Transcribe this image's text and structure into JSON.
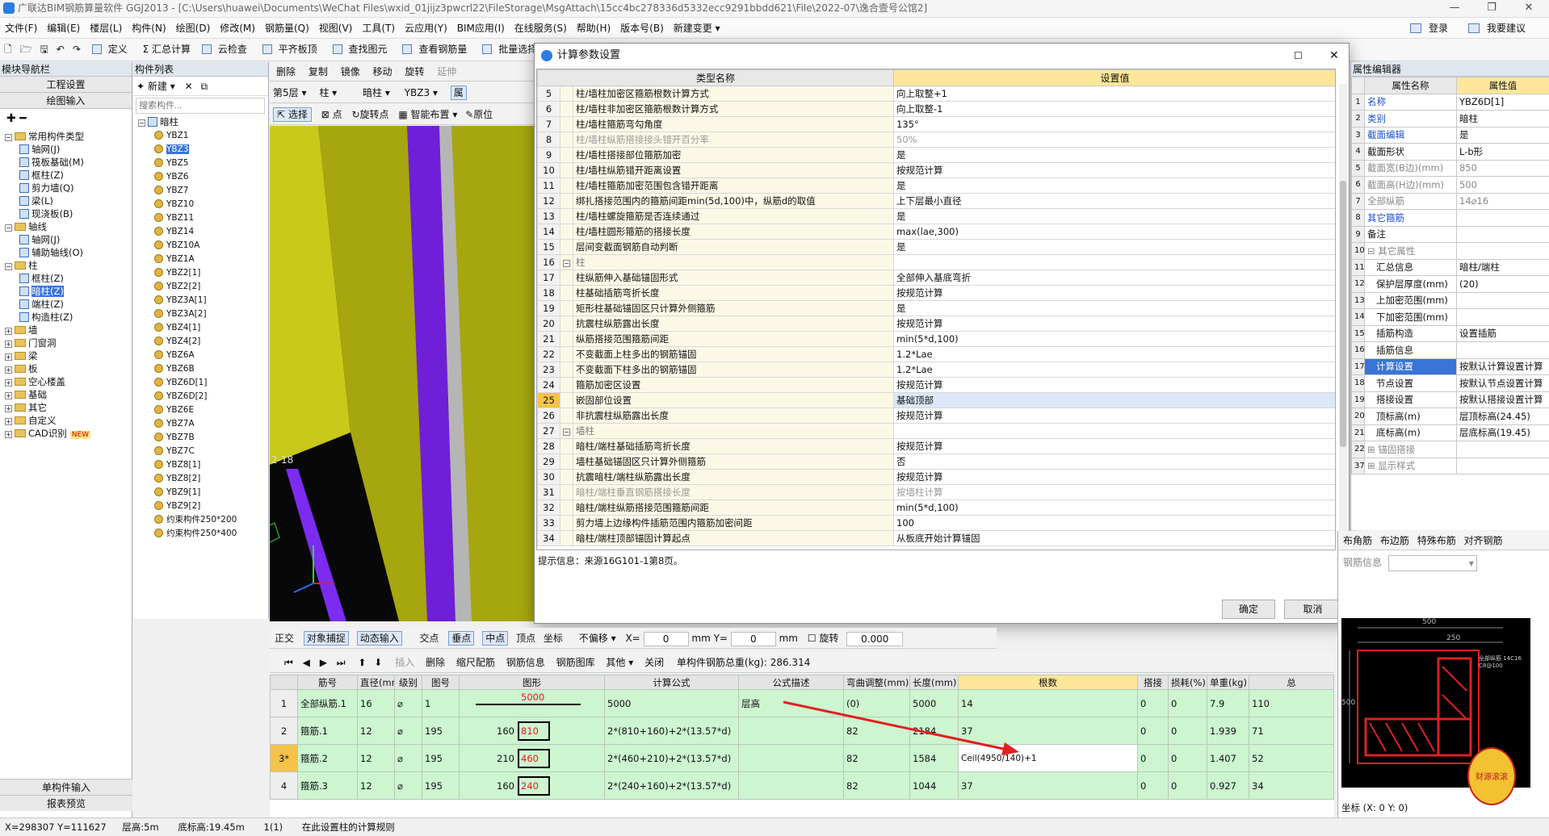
{
  "app": {
    "title": "广联达BIM钢筋算量软件 GGJ2013 - [C:\\Users\\huawei\\Documents\\WeChat Files\\wxid_01jijz3pwcrl22\\FileStorage\\MsgAttach\\15cc4bc278336d5332ecc9291bbdd621\\File\\2022-07\\逸合壹号公馆2]"
  },
  "menu": [
    "文件(F)",
    "编辑(E)",
    "楼层(L)",
    "构件(N)",
    "绘图(D)",
    "修改(M)",
    "钢筋量(Q)",
    "视图(V)",
    "工具(T)",
    "云应用(Y)",
    "BIM应用(I)",
    "在线服务(S)",
    "帮助(H)",
    "版本号(B)",
    "新建变更 ▾"
  ],
  "menu_right": {
    "login": "登录",
    "suggest": "我要建议"
  },
  "toolbar": [
    "定义",
    "Σ 汇总计算",
    "云检查",
    "平齐板顶",
    "查找图元",
    "查看钢筋量",
    "批量选择"
  ],
  "nav": {
    "title": "模块导航栏",
    "btn_project": "工程设置",
    "btn_draw": "绘图输入",
    "tree": [
      {
        "label": "常用构件类型",
        "type": "folder",
        "level": 0,
        "exp": "−"
      },
      {
        "label": "轴网(J)",
        "type": "leaf",
        "level": 1
      },
      {
        "label": "筏板基础(M)",
        "type": "leaf",
        "level": 1
      },
      {
        "label": "框柱(Z)",
        "type": "leaf",
        "level": 1
      },
      {
        "label": "剪力墙(Q)",
        "type": "leaf",
        "level": 1
      },
      {
        "label": "梁(L)",
        "type": "leaf",
        "level": 1
      },
      {
        "label": "现浇板(B)",
        "type": "leaf",
        "level": 1
      },
      {
        "label": "轴线",
        "type": "folder",
        "level": 0,
        "exp": "−"
      },
      {
        "label": "轴网(J)",
        "type": "leaf",
        "level": 1
      },
      {
        "label": "辅助轴线(O)",
        "type": "leaf",
        "level": 1
      },
      {
        "label": "柱",
        "type": "folder",
        "level": 0,
        "exp": "−"
      },
      {
        "label": "框柱(Z)",
        "type": "leaf",
        "level": 1
      },
      {
        "label": "暗柱(Z)",
        "type": "leaf",
        "level": 1,
        "selected": true
      },
      {
        "label": "端柱(Z)",
        "type": "leaf",
        "level": 1
      },
      {
        "label": "构造柱(Z)",
        "type": "leaf",
        "level": 1
      },
      {
        "label": "墙",
        "type": "folder",
        "level": 0,
        "exp": "+"
      },
      {
        "label": "门窗洞",
        "type": "folder",
        "level": 0,
        "exp": "+"
      },
      {
        "label": "梁",
        "type": "folder",
        "level": 0,
        "exp": "+"
      },
      {
        "label": "板",
        "type": "folder",
        "level": 0,
        "exp": "+"
      },
      {
        "label": "空心楼盖",
        "type": "folder",
        "level": 0,
        "exp": "+"
      },
      {
        "label": "基础",
        "type": "folder",
        "level": 0,
        "exp": "+"
      },
      {
        "label": "其它",
        "type": "folder",
        "level": 0,
        "exp": "+"
      },
      {
        "label": "自定义",
        "type": "folder",
        "level": 0,
        "exp": "+"
      },
      {
        "label": "CAD识别",
        "type": "folder",
        "level": 0,
        "exp": "+",
        "badge": "NEW"
      }
    ],
    "btn_single": "单构件输入",
    "btn_report": "报表预览"
  },
  "complist": {
    "title": "构件列表",
    "new_label": "新建",
    "search_placeholder": "搜索构件...",
    "root": "暗柱",
    "items": [
      "YBZ1",
      "YBZ3",
      "YBZ5",
      "YBZ6",
      "YBZ7",
      "YBZ10",
      "YBZ11",
      "YBZ14",
      "YBZ10A",
      "YBZ1A",
      "YBZ2[1]",
      "YBZ2[2]",
      "YBZ3A[1]",
      "YBZ3A[2]",
      "YBZ4[1]",
      "YBZ4[2]",
      "YBZ6A",
      "YBZ6B",
      "YBZ6D[1]",
      "YBZ6D[2]",
      "YBZ6E",
      "YBZ7A",
      "YBZ7B",
      "YBZ7C",
      "YBZ8[1]",
      "YBZ8[2]",
      "YBZ9[1]",
      "YBZ9[2]",
      "约束构件250*200",
      "约束构件250*400"
    ],
    "selected_index": 1
  },
  "drawtoolbar": {
    "row1": [
      "删除",
      "复制",
      "镜像",
      "移动",
      "旋转",
      "延伸"
    ],
    "floor": "第5层",
    "kind": "柱",
    "sub": "暗柱",
    "comp": "YBZ3",
    "prop": "属",
    "row2": [
      "选择",
      "点",
      "旋转点",
      "智能布置",
      "原位"
    ]
  },
  "viewport": {
    "axis_label": "2-18"
  },
  "dialog": {
    "title": "计算参数设置",
    "col_name": "类型名称",
    "col_value": "设置值",
    "rows": [
      {
        "n": "5",
        "name": "柱/墙柱加密区箍筋根数计算方式",
        "value": "向上取整+1"
      },
      {
        "n": "6",
        "name": "柱/墙柱非加密区箍筋根数计算方式",
        "value": "向上取整-1"
      },
      {
        "n": "7",
        "name": "柱/墙柱箍筋弯勾角度",
        "value": "135°"
      },
      {
        "n": "8",
        "name": "柱/墙柱纵筋搭接接头错开百分率",
        "value": "50%",
        "grey": true
      },
      {
        "n": "9",
        "name": "柱/墙柱搭接部位箍筋加密",
        "value": "是"
      },
      {
        "n": "10",
        "name": "柱/墙柱纵筋错开距离设置",
        "value": "按规范计算"
      },
      {
        "n": "11",
        "name": "柱/墙柱箍筋加密范围包含错开距离",
        "value": "是"
      },
      {
        "n": "12",
        "name": "绑扎搭接范围内的箍筋间距min(5d,100)中，纵筋d的取值",
        "value": "上下层最小直径"
      },
      {
        "n": "13",
        "name": "柱/墙柱螺旋箍筋是否连续通过",
        "value": "是"
      },
      {
        "n": "14",
        "name": "柱/墙柱圆形箍筋的搭接长度",
        "value": "max(lae,300)"
      },
      {
        "n": "15",
        "name": "层间变截面钢筋自动判断",
        "value": "是"
      },
      {
        "n": "16",
        "name": "柱",
        "value": "",
        "group": true
      },
      {
        "n": "17",
        "name": "柱纵筋伸入基础锚固形式",
        "value": "全部伸入基底弯折"
      },
      {
        "n": "18",
        "name": "柱基础插筋弯折长度",
        "value": "按规范计算"
      },
      {
        "n": "19",
        "name": "矩形柱基础锚固区只计算外侧箍筋",
        "value": "是"
      },
      {
        "n": "20",
        "name": "抗震柱纵筋露出长度",
        "value": "按规范计算"
      },
      {
        "n": "21",
        "name": "纵筋搭接范围箍筋间距",
        "value": "min(5*d,100)"
      },
      {
        "n": "22",
        "name": "不变截面上柱多出的钢筋锚固",
        "value": "1.2*Lae"
      },
      {
        "n": "23",
        "name": "不变截面下柱多出的钢筋锚固",
        "value": "1.2*Lae"
      },
      {
        "n": "24",
        "name": "箍筋加密区设置",
        "value": "按规范计算"
      },
      {
        "n": "25",
        "name": "嵌固部位设置",
        "value": "基础顶部",
        "highlight": true
      },
      {
        "n": "26",
        "name": "非抗震柱纵筋露出长度",
        "value": "按规范计算"
      },
      {
        "n": "27",
        "name": "墙柱",
        "value": "",
        "group": true
      },
      {
        "n": "28",
        "name": "暗柱/端柱基础插筋弯折长度",
        "value": "按规范计算"
      },
      {
        "n": "29",
        "name": "墙柱基础锚固区只计算外侧箍筋",
        "value": "否"
      },
      {
        "n": "30",
        "name": "抗震暗柱/端柱纵筋露出长度",
        "value": "按规范计算"
      },
      {
        "n": "31",
        "name": "暗柱/端柱垂直钢筋搭接长度",
        "value": "按墙柱计算",
        "grey": true
      },
      {
        "n": "32",
        "name": "暗柱/端柱纵筋搭接范围箍筋间距",
        "value": "min(5*d,100)"
      },
      {
        "n": "33",
        "name": "剪力墙上边缘构件插筋范围内箍筋加密间距",
        "value": "100"
      },
      {
        "n": "34",
        "name": "暗柱/端柱顶部锚固计算起点",
        "value": "从板底开始计算锚固"
      }
    ],
    "hint": "提示信息：来源16G101-1第8页。",
    "ok": "确定",
    "cancel": "取消"
  },
  "props": {
    "title": "属性编辑器",
    "col_name": "属性名称",
    "col_value": "属性值",
    "rows": [
      {
        "n": "1",
        "name": "名称",
        "value": "YBZ6D[1]",
        "blue": true
      },
      {
        "n": "2",
        "name": "类别",
        "value": "暗柱",
        "blue": true
      },
      {
        "n": "3",
        "name": "截面编辑",
        "value": "是",
        "blue": true
      },
      {
        "n": "4",
        "name": "截面形状",
        "value": "L-b形"
      },
      {
        "n": "5",
        "name": "截面宽(B边)(mm)",
        "value": "850",
        "grey": true
      },
      {
        "n": "6",
        "name": "截面高(H边)(mm)",
        "value": "500",
        "grey": true
      },
      {
        "n": "7",
        "name": "全部纵筋",
        "value": "14⌀16",
        "grey": true
      },
      {
        "n": "8",
        "name": "其它箍筋",
        "value": "",
        "blue": true
      },
      {
        "n": "9",
        "name": "备注",
        "value": ""
      },
      {
        "n": "10",
        "name": "⊟ 其它属性",
        "value": "",
        "grey": true
      },
      {
        "n": "11",
        "name": "汇总信息",
        "value": "暗柱/端柱",
        "indent": true
      },
      {
        "n": "12",
        "name": "保护层厚度(mm)",
        "value": "(20)",
        "indent": true
      },
      {
        "n": "13",
        "name": "上加密范围(mm)",
        "value": "",
        "indent": true
      },
      {
        "n": "14",
        "name": "下加密范围(mm)",
        "value": "",
        "indent": true
      },
      {
        "n": "15",
        "name": "插筋构造",
        "value": "设置插筋",
        "indent": true
      },
      {
        "n": "16",
        "name": "插筋信息",
        "value": "",
        "indent": true
      },
      {
        "n": "17",
        "name": "计算设置",
        "value": "按默认计算设置计算",
        "indent": true,
        "selected": true
      },
      {
        "n": "18",
        "name": "节点设置",
        "value": "按默认节点设置计算",
        "indent": true
      },
      {
        "n": "19",
        "name": "搭接设置",
        "value": "按默认搭接设置计算",
        "indent": true
      },
      {
        "n": "20",
        "name": "顶标高(m)",
        "value": "层顶标高(24.45)",
        "indent": true
      },
      {
        "n": "21",
        "name": "底标高(m)",
        "value": "层底标高(19.45)",
        "indent": true
      },
      {
        "n": "22",
        "name": "⊞ 锚固搭接",
        "value": "",
        "grey": true
      },
      {
        "n": "37",
        "name": "⊞ 显示样式",
        "value": "",
        "grey": true
      }
    ]
  },
  "rebar_panel": {
    "tabs": [
      "布角筋",
      "布边筋",
      "特殊布筋",
      "对齐钢筋"
    ],
    "info_label": "钢筋信息",
    "dims": [
      "500",
      "250",
      "500"
    ],
    "section_text": "全部纵筋 14C16 C8@100",
    "coord": "坐标 (X: 0 Y: 0)",
    "mascot": "财源滚滚"
  },
  "snapbar": {
    "items": [
      "正交",
      "对象捕捉",
      "动态输入",
      "交点",
      "垂点",
      "中点",
      "顶点",
      "坐标"
    ],
    "nooffset": "不偏移",
    "x_label": "X=",
    "x": "0",
    "y_label": "mm Y=",
    "y": "0",
    "mm": "mm",
    "rotate": "旋转",
    "angle": "0.000"
  },
  "rebartool": {
    "items": [
      "插入",
      "删除",
      "缩尺配筋",
      "钢筋信息",
      "钢筋图库",
      "其他 ▾",
      "关闭"
    ],
    "total": "单构件钢筋总重(kg): 286.314"
  },
  "rebartable": {
    "headers": [
      "",
      "筋号",
      "直径(mm)",
      "级别",
      "图号",
      "图形",
      "计算公式",
      "公式描述",
      "弯曲调整(mm)",
      "长度(mm)",
      "根数",
      "搭接",
      "损耗(%)",
      "单重(kg)",
      "总"
    ],
    "rows": [
      {
        "n": "1",
        "name": "全部纵筋.1",
        "d": "16",
        "grade": "⌀",
        "fig": "1",
        "shape_a": "",
        "shape_b": "5000",
        "formula": "5000",
        "desc": "层高",
        "bend": "(0)",
        "len": "5000",
        "count": "14",
        "lap": "0",
        "loss": "0",
        "unit": "7.9",
        "total": "110"
      },
      {
        "n": "2",
        "name": "箍筋.1",
        "d": "12",
        "grade": "⌀",
        "fig": "195",
        "shape_a": "160",
        "shape_b": "810",
        "formula": "2*(810+160)+2*(13.57*d)",
        "desc": "",
        "bend": "82",
        "len": "2184",
        "count": "37",
        "lap": "0",
        "loss": "0",
        "unit": "1.939",
        "total": "71"
      },
      {
        "n": "3*",
        "name": "箍筋.2",
        "d": "12",
        "grade": "⌀",
        "fig": "195",
        "shape_a": "210",
        "shape_b": "460",
        "formula": "2*(460+210)+2*(13.57*d)",
        "desc": "",
        "bend": "82",
        "len": "1584",
        "count": "Ceil(4950/140)+1",
        "lap": "0",
        "loss": "0",
        "unit": "1.407",
        "total": "52"
      },
      {
        "n": "4",
        "name": "箍筋.3",
        "d": "12",
        "grade": "⌀",
        "fig": "195",
        "shape_a": "160",
        "shape_b": "240",
        "formula": "2*(240+160)+2*(13.57*d)",
        "desc": "",
        "bend": "82",
        "len": "1044",
        "count": "37",
        "lap": "0",
        "loss": "0",
        "unit": "0.927",
        "total": "34"
      }
    ]
  },
  "status": {
    "coord": "X=298307 Y=111627",
    "floor_h": "层高:5m",
    "base_h": "底标高:19.45m",
    "count": "1(1)",
    "msg": "在此设置柱的计算规则"
  },
  "colors": {
    "accent": "#3875d7",
    "prop_header": "#fde69a",
    "dlg_value_header": "#fde69a",
    "rebar_row": "#ccf5d0",
    "arrow": "#e02020"
  }
}
